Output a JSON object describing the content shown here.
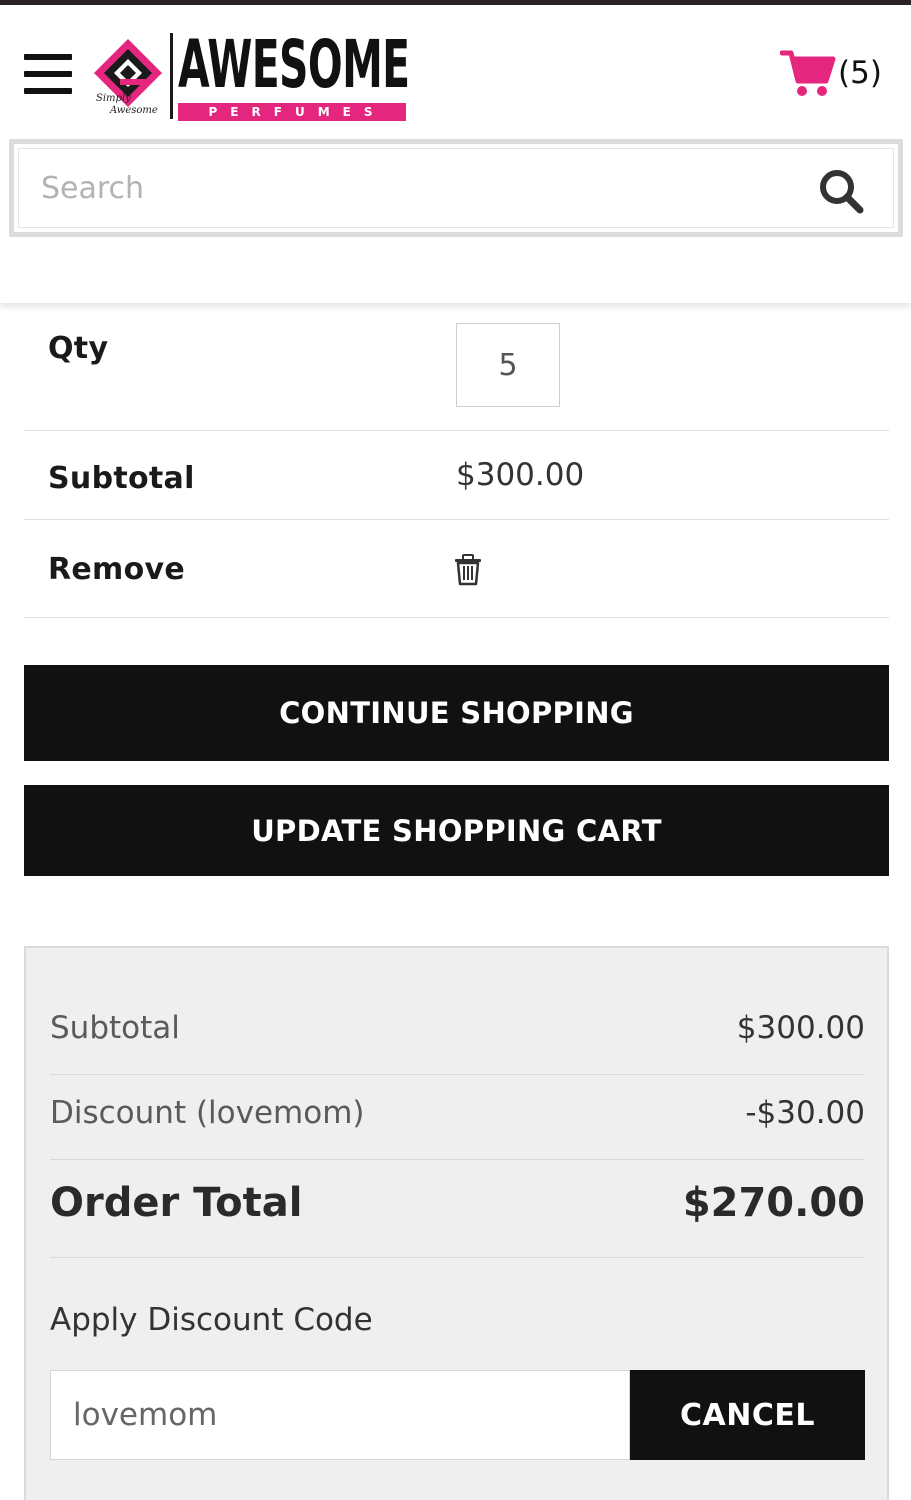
{
  "header": {
    "menu_icon": "hamburger-menu-icon",
    "logo": {
      "word": "AWESOME",
      "band": "PERFUMES",
      "tagline_line1": "Simply",
      "tagline_line2": "Awesome"
    },
    "cart": {
      "icon": "shopping-cart-icon",
      "count": "(5)",
      "icon_color": "#e5267e"
    },
    "search": {
      "placeholder": "Search",
      "icon": "search-icon"
    }
  },
  "cart_item": {
    "qty_label": "Qty",
    "qty_value": "5",
    "subtotal_label": "Subtotal",
    "subtotal_value": "$300.00",
    "remove_label": "Remove",
    "remove_icon": "trash-icon"
  },
  "actions": {
    "continue_label": "CONTINUE SHOPPING",
    "update_label": "UPDATE SHOPPING CART"
  },
  "summary": {
    "subtotal_label": "Subtotal",
    "subtotal_value": "$300.00",
    "discount_label": "Discount (lovemom)",
    "discount_value": "-$30.00",
    "total_label": "Order Total",
    "total_value": "$270.00",
    "apply_label": "Apply Discount Code",
    "code_value": "lovemom",
    "cancel_label": "CANCEL"
  },
  "colors": {
    "brand_pink": "#e5267e",
    "button_black": "#111111",
    "summary_bg": "#efefef"
  }
}
